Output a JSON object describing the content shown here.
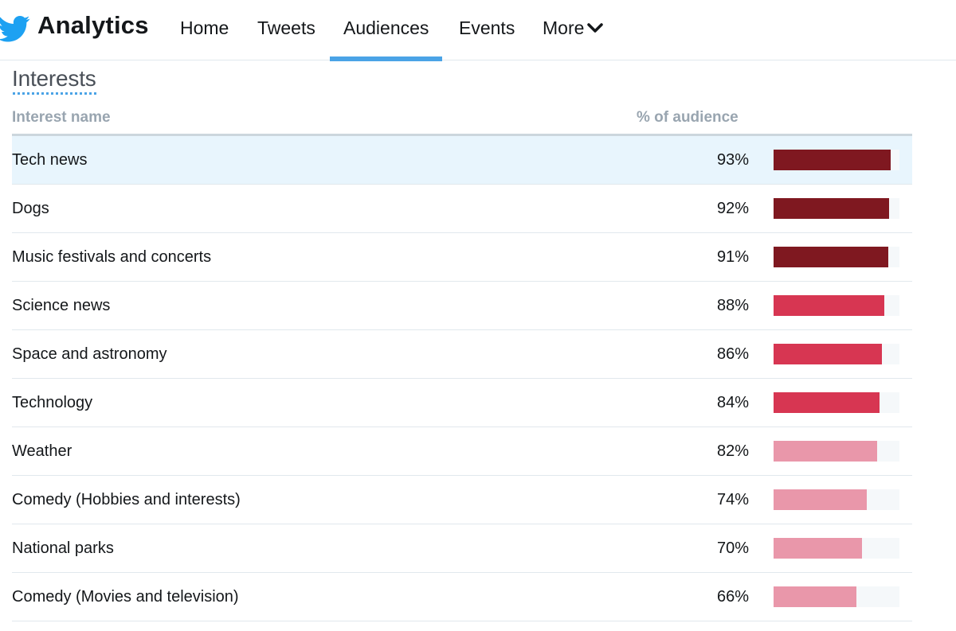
{
  "app": {
    "brand": "Analytics",
    "logo_icon": "twitter-bird-icon",
    "brand_color": "#1da1f2"
  },
  "nav": {
    "home": "Home",
    "tweets": "Tweets",
    "audiences": "Audiences",
    "events": "Events",
    "more": "More",
    "active": "Audiences",
    "more_icon": "chevron-down-icon",
    "active_color": "#4aa3e6"
  },
  "section": {
    "title": "Interests"
  },
  "table": {
    "headers": {
      "name": "Interest name",
      "pct": "% of audience"
    },
    "rows": [
      {
        "name": "Tech news",
        "pct_label": "93%",
        "value": 93,
        "color": "#7f1820",
        "highlight": true
      },
      {
        "name": "Dogs",
        "pct_label": "92%",
        "value": 92,
        "color": "#7f1820",
        "highlight": false
      },
      {
        "name": "Music festivals and concerts",
        "pct_label": "91%",
        "value": 91,
        "color": "#7f1820",
        "highlight": false
      },
      {
        "name": "Science news",
        "pct_label": "88%",
        "value": 88,
        "color": "#d73652",
        "highlight": false
      },
      {
        "name": "Space and astronomy",
        "pct_label": "86%",
        "value": 86,
        "color": "#d73652",
        "highlight": false
      },
      {
        "name": "Technology",
        "pct_label": "84%",
        "value": 84,
        "color": "#d73652",
        "highlight": false
      },
      {
        "name": "Weather",
        "pct_label": "82%",
        "value": 82,
        "color": "#e997aa",
        "highlight": false
      },
      {
        "name": "Comedy (Hobbies and interests)",
        "pct_label": "74%",
        "value": 74,
        "color": "#e997aa",
        "highlight": false
      },
      {
        "name": "National parks",
        "pct_label": "70%",
        "value": 70,
        "color": "#e997aa",
        "highlight": false
      },
      {
        "name": "Comedy (Movies and television)",
        "pct_label": "66%",
        "value": 66,
        "color": "#e997aa",
        "highlight": false
      }
    ]
  }
}
